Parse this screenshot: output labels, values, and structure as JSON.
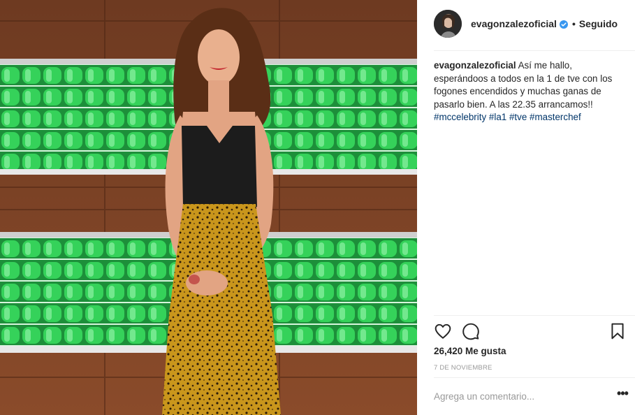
{
  "post": {
    "photo": {
      "description_icon": "photo",
      "colors": {
        "wood": "#7a4126",
        "wood_dark": "#5b2e19",
        "green_lights": "#27c34a",
        "top": "#1c1c1c",
        "skirt": "#c9961c"
      }
    },
    "header": {
      "username": "evagonzalezoficial",
      "verified_icon": "verified-badge-icon",
      "separator": "•",
      "follow_status": "Seguido"
    },
    "caption": {
      "username": "evagonzalezoficial",
      "text": "Así me hallo, esperándoos a todos en la 1 de tve con los fogones encendidos y muchas ganas de pasarlo bien. A las 22.35 arrancamos!!",
      "hashtags": [
        "#mccelebrity",
        "#la1",
        "#tve",
        "#masterchef"
      ]
    },
    "actions": {
      "like_icon": "heart-icon",
      "comment_icon": "comment-icon",
      "save_icon": "bookmark-icon"
    },
    "likes": "26,420 Me gusta",
    "date": "7 DE NOVIEMBRE",
    "comment_box": {
      "placeholder": "Agrega un comentario...",
      "more_label": "•••"
    }
  }
}
